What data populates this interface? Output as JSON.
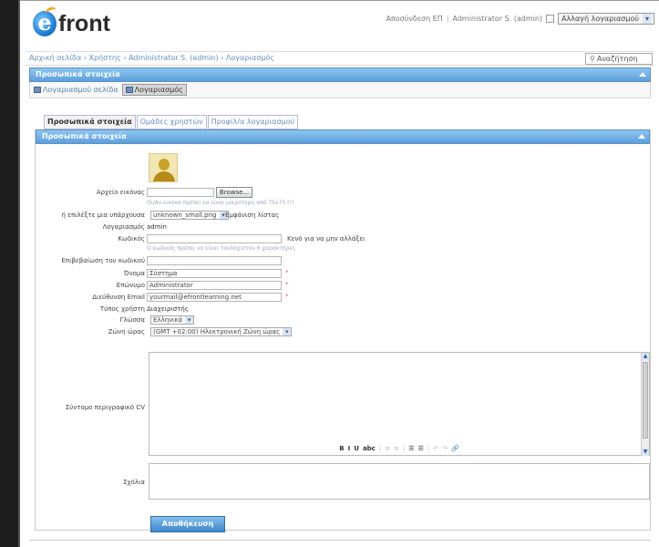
{
  "app": {
    "logo_text": "front",
    "top_links": [
      "Αποσύνδεση ΕΠ",
      "Administrator S. (admin)"
    ],
    "role_select": "Αλλαγή λογαριασμού"
  },
  "breadcrumb": "Αρχική σελίδα › Χρήστης › Administrator S. (admin) › Λογαριασμός",
  "search": {
    "placeholder": "Αναζήτηση"
  },
  "outer_panel": {
    "title": "Προσωπικά στοιχεία",
    "toolbar": {
      "link_label": "Λογαριασμού σελίδα",
      "button_label": "Λογαριασμός"
    }
  },
  "tabs": [
    {
      "label": "Προσωπικά στοιχεία",
      "active": true
    },
    {
      "label": "Ομάδες χρηστών",
      "active": false
    },
    {
      "label": "Προφίλ/α λογαριασμού",
      "active": false
    }
  ],
  "inner_panel": {
    "title": "Προσωπικά στοιχεία"
  },
  "form": {
    "avatar_label": "Αρχείο εικόνας",
    "browse_label": "Browse...",
    "avatar_hint": "Οι/Αν εικόνα πρέπει να είναι μικρότερη από 75x75 (!)",
    "existing_image_label": "ή επιλέξτε μια υπάρχουσα",
    "existing_image_value": "unknown_small.png",
    "existing_image_extra": "Εμφάνιση λίστας",
    "account_label": "Λογαριασμός",
    "account_value": "admin",
    "password_label": "Κωδικός",
    "password_note": "Κενό για να μην αλλάξει",
    "password_hint": "Ο κωδικός πρέπει να είναι τουλάχιστον 6 χαρακτήρες",
    "confirm_label": "Επιβεβαίωση του κωδικού",
    "first_name_label": "Όνομα",
    "first_name_value": "Σύστημα",
    "last_name_label": "Επώνυμο",
    "last_name_value": "Administrator",
    "email_label": "Διεύθυνση Email",
    "email_value": "yourmail@efrontlearning.net",
    "user_type_label": "Τύπος χρήστη",
    "user_type_value": "Διαχειριστής",
    "language_label": "Γλώσσα",
    "language_value": "Ελληνικά",
    "timezone_label": "Ζώνη ώρας",
    "timezone_value": "(GMT +02:00) Ηλεκτρονική Ζώνη ώρας",
    "cv_label": "Σύντομο περιγραφικό CV",
    "signature_label": "Σχόλια",
    "submit_label": "Αποθήκευση"
  },
  "editor_toolbar": [
    "B",
    "I",
    "U",
    "abc",
    "|",
    "≡",
    "≡",
    "|",
    "☰",
    "☰",
    "|",
    "↶",
    "↷",
    "🔗"
  ]
}
